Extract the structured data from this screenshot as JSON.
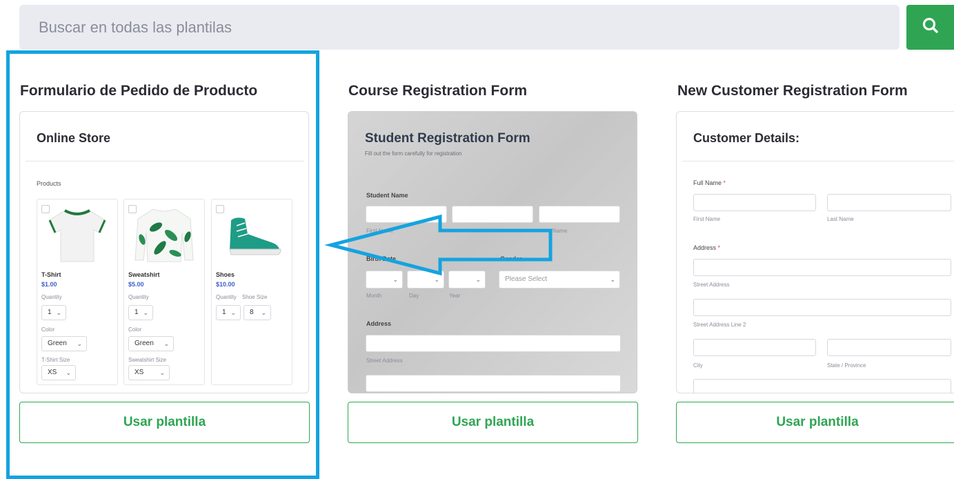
{
  "search": {
    "placeholder": "Buscar en todas las plantilas",
    "button_icon": "search-icon"
  },
  "colors": {
    "accent_green": "#2fa553",
    "highlight_blue": "#14a3e0",
    "price_blue": "#3d5ec9"
  },
  "cards": [
    {
      "title": "Formulario de Pedido de Producto",
      "button": "Usar plantilla",
      "preview": {
        "heading": "Online Store",
        "section": "Products",
        "products": [
          {
            "name": "T-Shirt",
            "price": "$1.00",
            "qty_label": "Quantity",
            "qty": "1",
            "color_label": "Color",
            "color": "Green",
            "size_label": "T-Shirt Size",
            "size": "XS"
          },
          {
            "name": "Sweatshirt",
            "price": "$5.00",
            "qty_label": "Quantity",
            "qty": "1",
            "color_label": "Color",
            "color": "Green",
            "size_label": "Sweatshirt Size",
            "size": "XS"
          },
          {
            "name": "Shoes",
            "price": "$10.00",
            "qty_label": "Quantity",
            "qty": "1",
            "size_label": "Shoe Size",
            "size": "8"
          }
        ]
      }
    },
    {
      "title": "Course Registration Form",
      "button": "Usar plantilla",
      "preview": {
        "heading": "Student Registration Form",
        "subheading": "Fill out the form carefully for registration",
        "student_name_label": "Student Name",
        "first_name": "First Name",
        "last_name": "Name",
        "birth_date_label": "Birth Date",
        "gender_label": "Gender",
        "gender_select": "Please Select",
        "month": "Month",
        "day": "Day",
        "year": "Year",
        "address_label": "Address",
        "street_address": "Street Address"
      }
    },
    {
      "title": "New Customer Registration Form",
      "button": "Usar plantilla",
      "preview": {
        "heading": "Customer Details:",
        "full_name_label": "Full Name",
        "required_mark": "*",
        "first_name": "First Name",
        "last_name": "Last Name",
        "address_label": "Address",
        "street_address": "Street Address",
        "street_address_2": "Street Address Line 2",
        "city": "City",
        "state": "State / Province"
      }
    }
  ]
}
